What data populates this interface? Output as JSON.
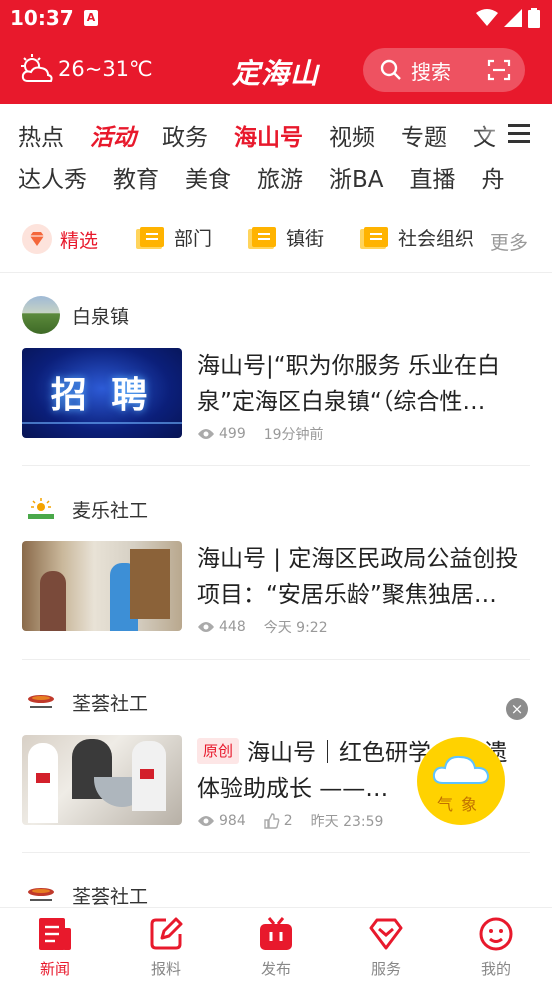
{
  "status": {
    "time": "10:37",
    "app_badge": "A"
  },
  "header": {
    "weather": "26~31℃",
    "logo": "定海山",
    "search_placeholder": "搜索"
  },
  "channels": {
    "row1": [
      "热点",
      "活动",
      "政务",
      "海山号",
      "视频",
      "专题",
      "文"
    ],
    "row2": [
      "达人秀",
      "教育",
      "美食",
      "旅游",
      "浙BA",
      "直播",
      "舟"
    ]
  },
  "subtabs": {
    "items": [
      "精选",
      "部门",
      "镇街",
      "社会组织"
    ],
    "more": "更多"
  },
  "news": [
    {
      "source": "白泉镇",
      "thumb_text": "招 聘",
      "title": "海山号|“职为你服务 乐业在白泉”定海区白泉镇“（综合性…",
      "views": "499",
      "time": "19分钟前"
    },
    {
      "source": "麦乐社工",
      "title": "海山号 | 定海区民政局公益创投项目：“安居乐龄”聚焦独居…",
      "views": "448",
      "time": "今天 9:22"
    },
    {
      "source": "荃荟社工",
      "tag": "原创",
      "title": "海山号｜红色研学 心非遗体验助成长 ——…",
      "views": "984",
      "likes": "2",
      "time": "昨天 23:59"
    },
    {
      "source": "荃荟社工"
    }
  ],
  "floating": {
    "weather_label": "气象",
    "close": "×"
  },
  "bottom_nav": [
    "新闻",
    "报料",
    "发布",
    "服务",
    "我的"
  ],
  "colors": {
    "accent": "#e8192c"
  }
}
